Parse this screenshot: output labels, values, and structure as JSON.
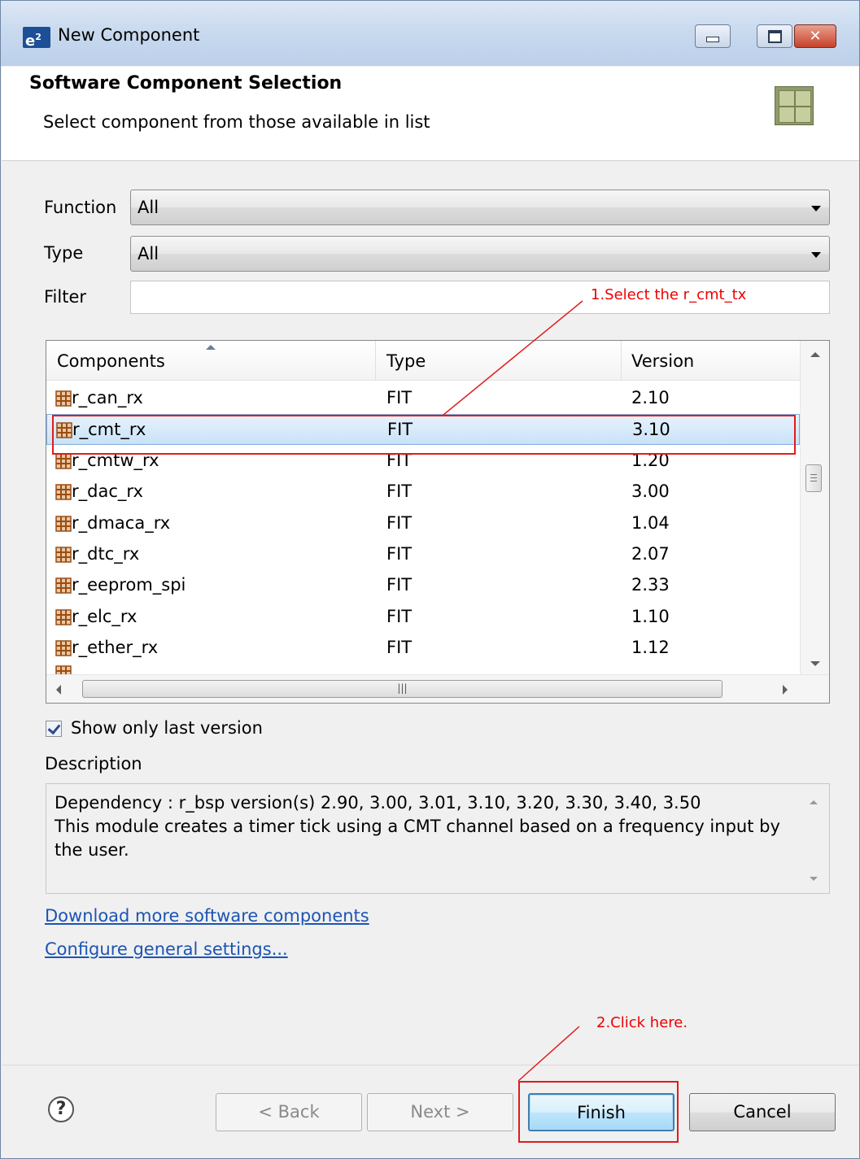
{
  "window": {
    "title": "New Component",
    "app_icon_label": "e",
    "app_icon_sup": "2",
    "controls": [
      "minimize-icon",
      "maximize-icon",
      "close-icon"
    ]
  },
  "header": {
    "title": "Software Component Selection",
    "subtitle": "Select component from those available in list",
    "icon": "component-grid-icon"
  },
  "form": {
    "function_label": "Function",
    "function_value": "All",
    "type_label": "Type",
    "type_value": "All",
    "filter_label": "Filter",
    "filter_value": ""
  },
  "table": {
    "columns": [
      "Components",
      "Type",
      "Version"
    ],
    "rows": [
      {
        "name": "r_can_rx",
        "type": "FIT",
        "version": "2.10"
      },
      {
        "name": "r_cmt_rx",
        "type": "FIT",
        "version": "3.10",
        "selected": true
      },
      {
        "name": "r_cmtw_rx",
        "type": "FIT",
        "version": "1.20"
      },
      {
        "name": "r_dac_rx",
        "type": "FIT",
        "version": "3.00"
      },
      {
        "name": "r_dmaca_rx",
        "type": "FIT",
        "version": "1.04"
      },
      {
        "name": "r_dtc_rx",
        "type": "FIT",
        "version": "2.07"
      },
      {
        "name": "r_eeprom_spi",
        "type": "FIT",
        "version": "2.33"
      },
      {
        "name": "r_elc_rx",
        "type": "FIT",
        "version": "1.10"
      },
      {
        "name": "r_ether_rx",
        "type": "FIT",
        "version": "1.12"
      }
    ]
  },
  "options": {
    "show_last_version_label": "Show only last version",
    "show_last_version_checked": true
  },
  "description": {
    "label": "Description",
    "text": "Dependency : r_bsp version(s) 2.90, 3.00, 3.01, 3.10, 3.20, 3.30, 3.40, 3.50\nThis module creates a timer tick using a CMT channel based on a frequency input by the user."
  },
  "links": {
    "download": "Download more software components",
    "configure": "Configure general settings..."
  },
  "buttons": {
    "help": "?",
    "back": "< Back",
    "next": "Next >",
    "finish": "Finish",
    "cancel": "Cancel"
  },
  "annotations": {
    "step1": "1.Select the r_cmt_tx",
    "step2": "2.Click here.",
    "color": "#e21b1b"
  }
}
